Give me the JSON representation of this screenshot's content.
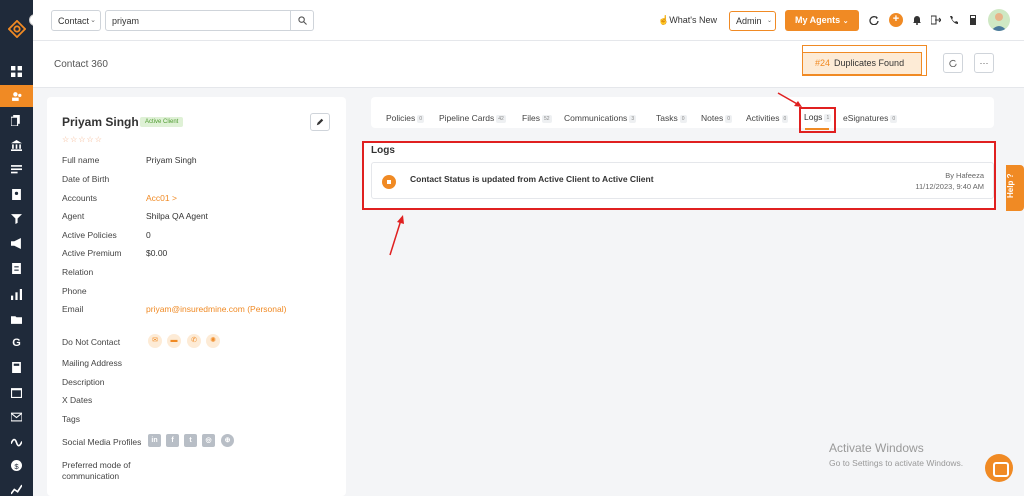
{
  "topbar": {
    "search_type": "Contact",
    "search_value": "priyam",
    "whats_new": "What's New",
    "role": "Admin",
    "agents_button": "My Agents"
  },
  "subheader": {
    "title": "Contact 360",
    "duplicates_number": "#24",
    "duplicates_label": "Duplicates Found",
    "more": "···"
  },
  "contact": {
    "name": "Priyam Singh",
    "status": "Active Client",
    "stars": "☆☆☆☆☆",
    "fields": [
      {
        "label": "Full name",
        "value": "Priyam Singh"
      },
      {
        "label": "Date of Birth",
        "value": ""
      },
      {
        "label": "Accounts",
        "value": "Acc01 >"
      },
      {
        "label": "Agent",
        "value": "Shilpa QA Agent"
      },
      {
        "label": "Active Policies",
        "value": "0"
      },
      {
        "label": "Active Premium",
        "value": "$0.00"
      },
      {
        "label": "Relation",
        "value": ""
      },
      {
        "label": "Phone",
        "value": ""
      },
      {
        "label": "Email",
        "value": "priyam@insuredmine.com  (Personal)"
      },
      {
        "label": "Do Not Contact",
        "value": ""
      },
      {
        "label": "Mailing Address",
        "value": ""
      },
      {
        "label": "Description",
        "value": ""
      },
      {
        "label": "X Dates",
        "value": ""
      },
      {
        "label": "Tags",
        "value": ""
      },
      {
        "label": "Social Media Profiles",
        "value": ""
      },
      {
        "label": "Preferred mode of",
        "value": ""
      },
      {
        "label": "communication",
        "value": ""
      }
    ],
    "social": [
      "in",
      "f",
      "t",
      "◎",
      "⊕"
    ]
  },
  "tabs": [
    {
      "label": "Policies",
      "count": "0"
    },
    {
      "label": "Pipeline Cards",
      "count": "42"
    },
    {
      "label": "Files",
      "count": "52"
    },
    {
      "label": "Communications",
      "count": "3"
    },
    {
      "label": "Tasks",
      "count": "0"
    },
    {
      "label": "Notes",
      "count": "0"
    },
    {
      "label": "Activities",
      "count": "0"
    },
    {
      "label": "Logs",
      "count": "1"
    },
    {
      "label": "eSignatures",
      "count": "0"
    }
  ],
  "logs": {
    "title": "Logs",
    "entries": [
      {
        "text": "Contact Status is updated from Active Client to Active Client",
        "by": "By Hafeeza",
        "date": "11/12/2023, 9:40 AM"
      }
    ]
  },
  "help_label": "Help",
  "windows": {
    "title": "Activate Windows",
    "subtitle": "Go to Settings to activate Windows."
  },
  "colors": {
    "accent": "#f08a24",
    "sidebar": "#1f2a3a",
    "highlight": "#e02020"
  }
}
